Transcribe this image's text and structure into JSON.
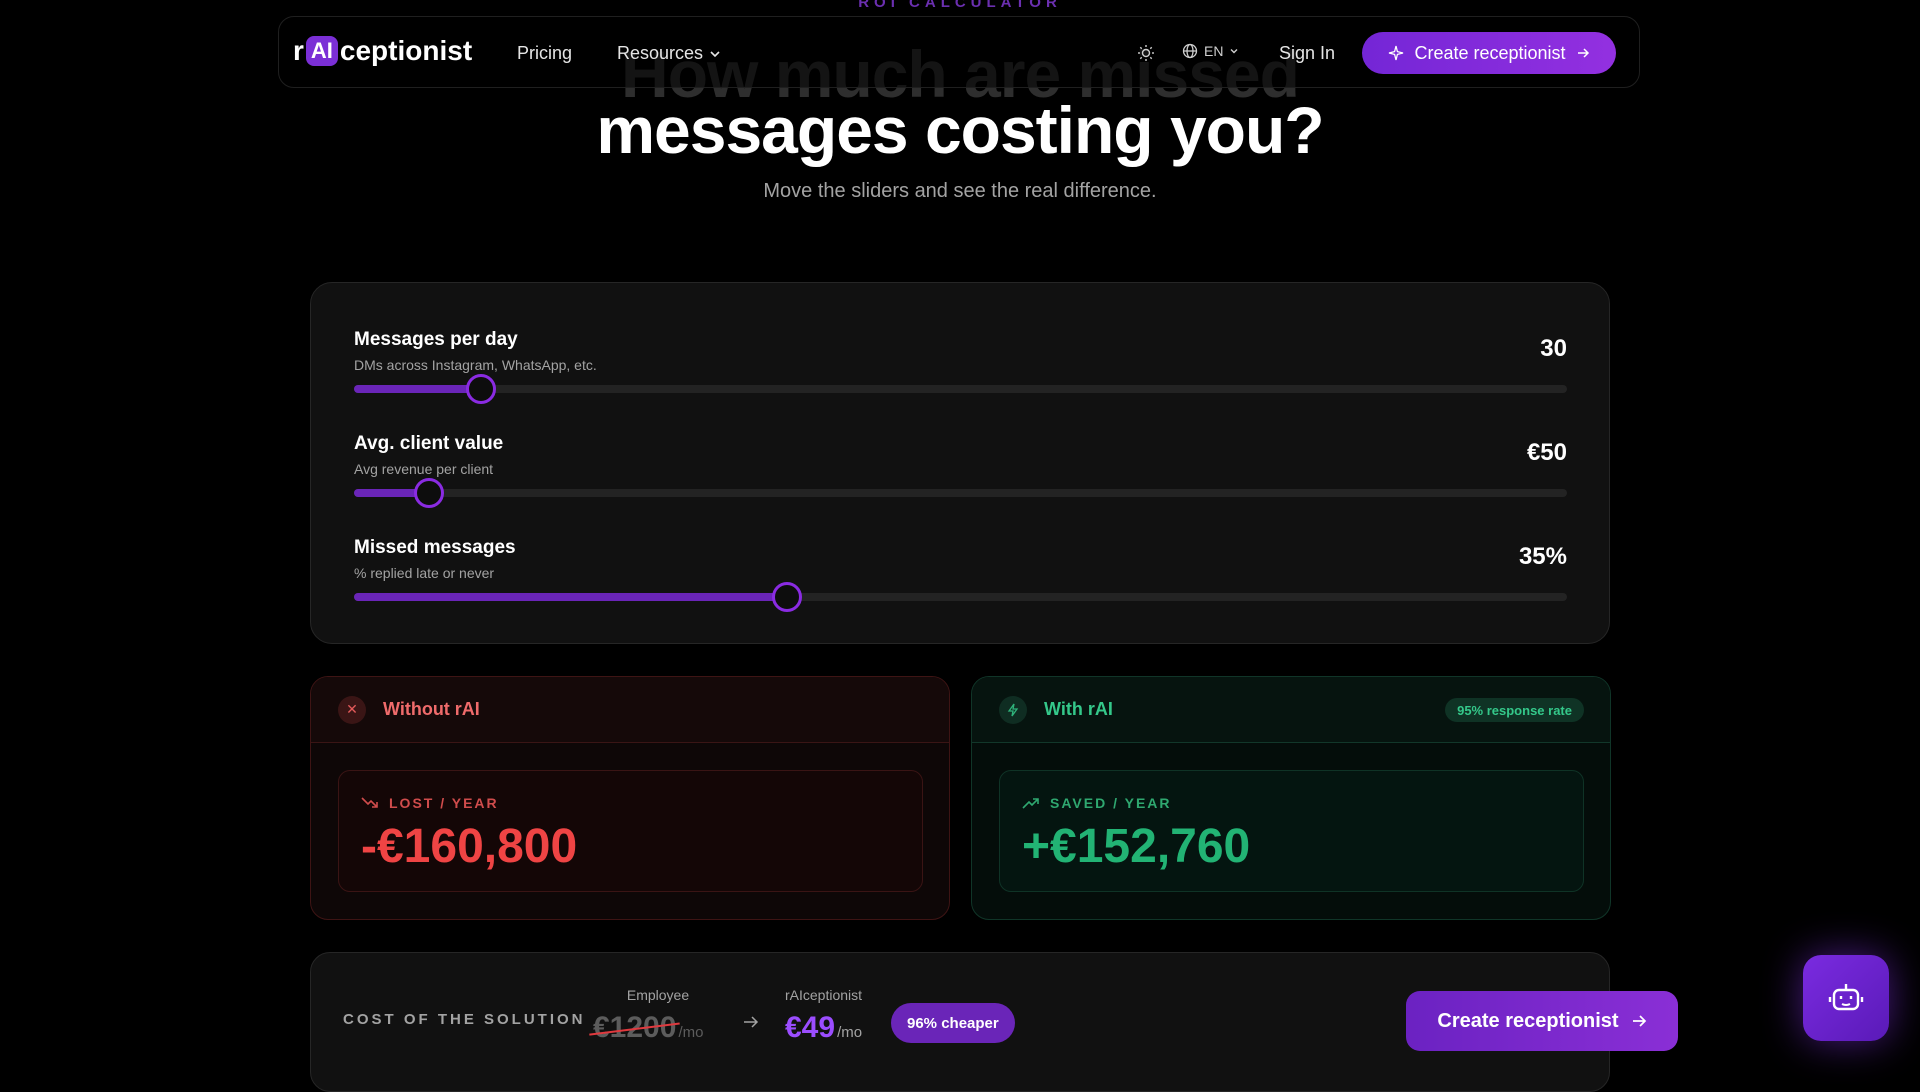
{
  "hero": {
    "eyebrow": "ROI CALCULATOR",
    "headline_top": "How much are missed",
    "headline": "messages costing you?",
    "subline": "Move the sliders and see the real difference."
  },
  "nav": {
    "logo_pre": "r",
    "logo_ai": "AI",
    "logo_post": "ceptionist",
    "pricing": "Pricing",
    "resources": "Resources",
    "lang": "EN",
    "signin": "Sign In",
    "cta": "Create receptionist"
  },
  "sliders": [
    {
      "label": "Messages per day",
      "hint": "DMs across Instagram, WhatsApp, etc.",
      "display": "30",
      "fill_percent": 10.5
    },
    {
      "label": "Avg. client value",
      "hint": "Avg revenue per client",
      "display": "€50",
      "fill_percent": 6.2
    },
    {
      "label": "Missed messages",
      "hint": "% replied late or never",
      "display": "35%",
      "fill_percent": 35.7
    }
  ],
  "without": {
    "title": "Without rAI",
    "label": "LOST / YEAR",
    "amount": "-€160,800"
  },
  "with": {
    "title": "With rAI",
    "badge": "95% response rate",
    "label": "SAVED / YEAR",
    "amount": "+€152,760"
  },
  "cost": {
    "label": "COST OF THE SOLUTION",
    "employee_caption": "Employee",
    "employee_price": "€1200",
    "per_month": "/mo",
    "rai_caption": "rAIceptionist",
    "rai_price": "€49",
    "cheaper": "96% cheaper",
    "cta": "Create receptionist"
  },
  "colors": {
    "accent": "#8a2be2",
    "loss": "#ef4444",
    "gain": "#22b374",
    "background": "#000000"
  },
  "icons": [
    "sun-icon",
    "globe-icon",
    "chevron-down-icon",
    "sparkle-icon",
    "arrow-right-icon",
    "close-icon",
    "bolt-icon",
    "trend-down-icon",
    "trend-up-icon",
    "robot-icon"
  ]
}
